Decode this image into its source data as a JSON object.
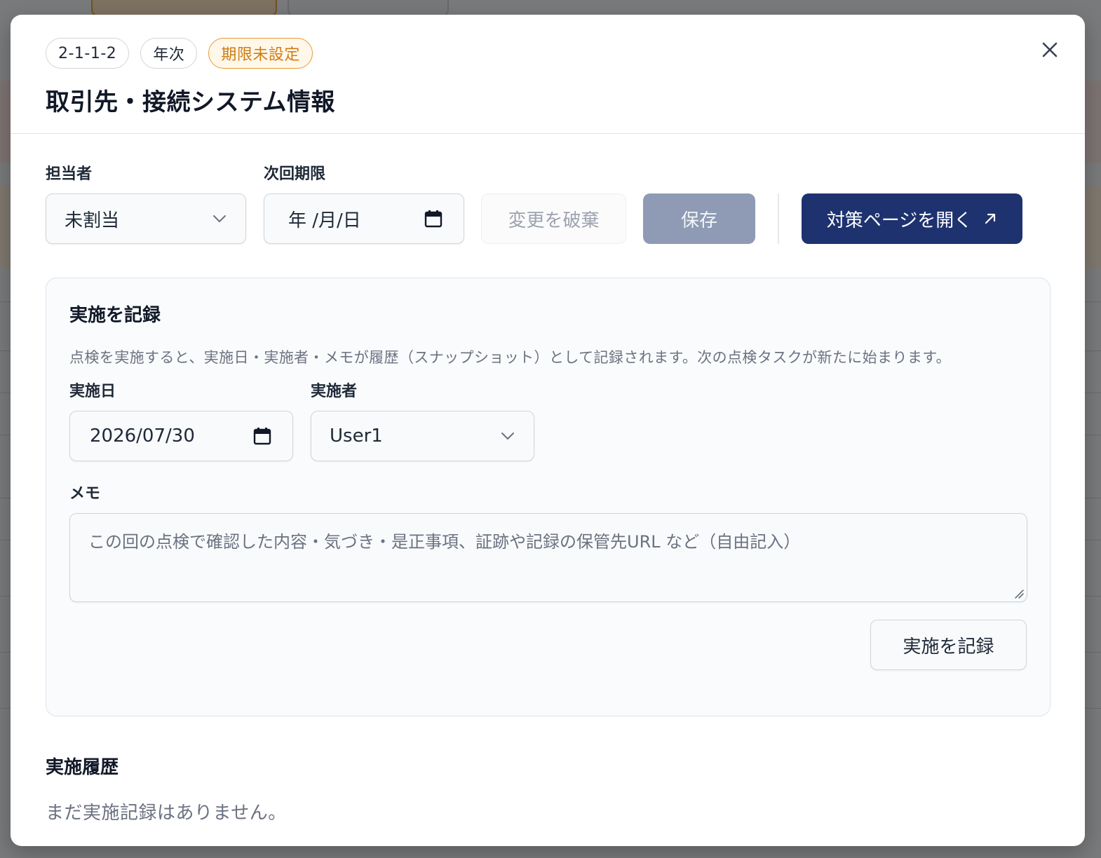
{
  "modal": {
    "chips": {
      "id": "2-1-1-2",
      "frequency": "年次",
      "status": "期限未設定"
    },
    "title": "取引先・接続システム情報"
  },
  "controls": {
    "assignee_label": "担当者",
    "assignee_value": "未割当",
    "deadline_label": "次回期限",
    "deadline_value": "年 /月/日",
    "discard_label": "変更を破棄",
    "save_label": "保存",
    "open_page_label": "対策ページを開く",
    "open_page_icon": "external-arrow-icon"
  },
  "record": {
    "title": "実施を記録",
    "description": "点検を実施すると、実施日・実施者・メモが履歴（スナップショット）として記録されます。次の点検タスクが新たに始まります。",
    "date_label": "実施日",
    "date_value": "2026/07/30",
    "performer_label": "実施者",
    "performer_value": "User1",
    "memo_label": "メモ",
    "memo_placeholder": "この回の点検で確認した内容・気づき・是正事項、証跡や記録の保管先URL など（自由記入）",
    "submit_label": "実施を記録"
  },
  "history": {
    "title": "実施履歴",
    "empty_message": "まだ実施記録はありません。"
  },
  "colors": {
    "primary": "#1e3270",
    "save_disabled": "#8f9bb5",
    "warning": "#d17d10",
    "muted_text": "#6b7280"
  }
}
